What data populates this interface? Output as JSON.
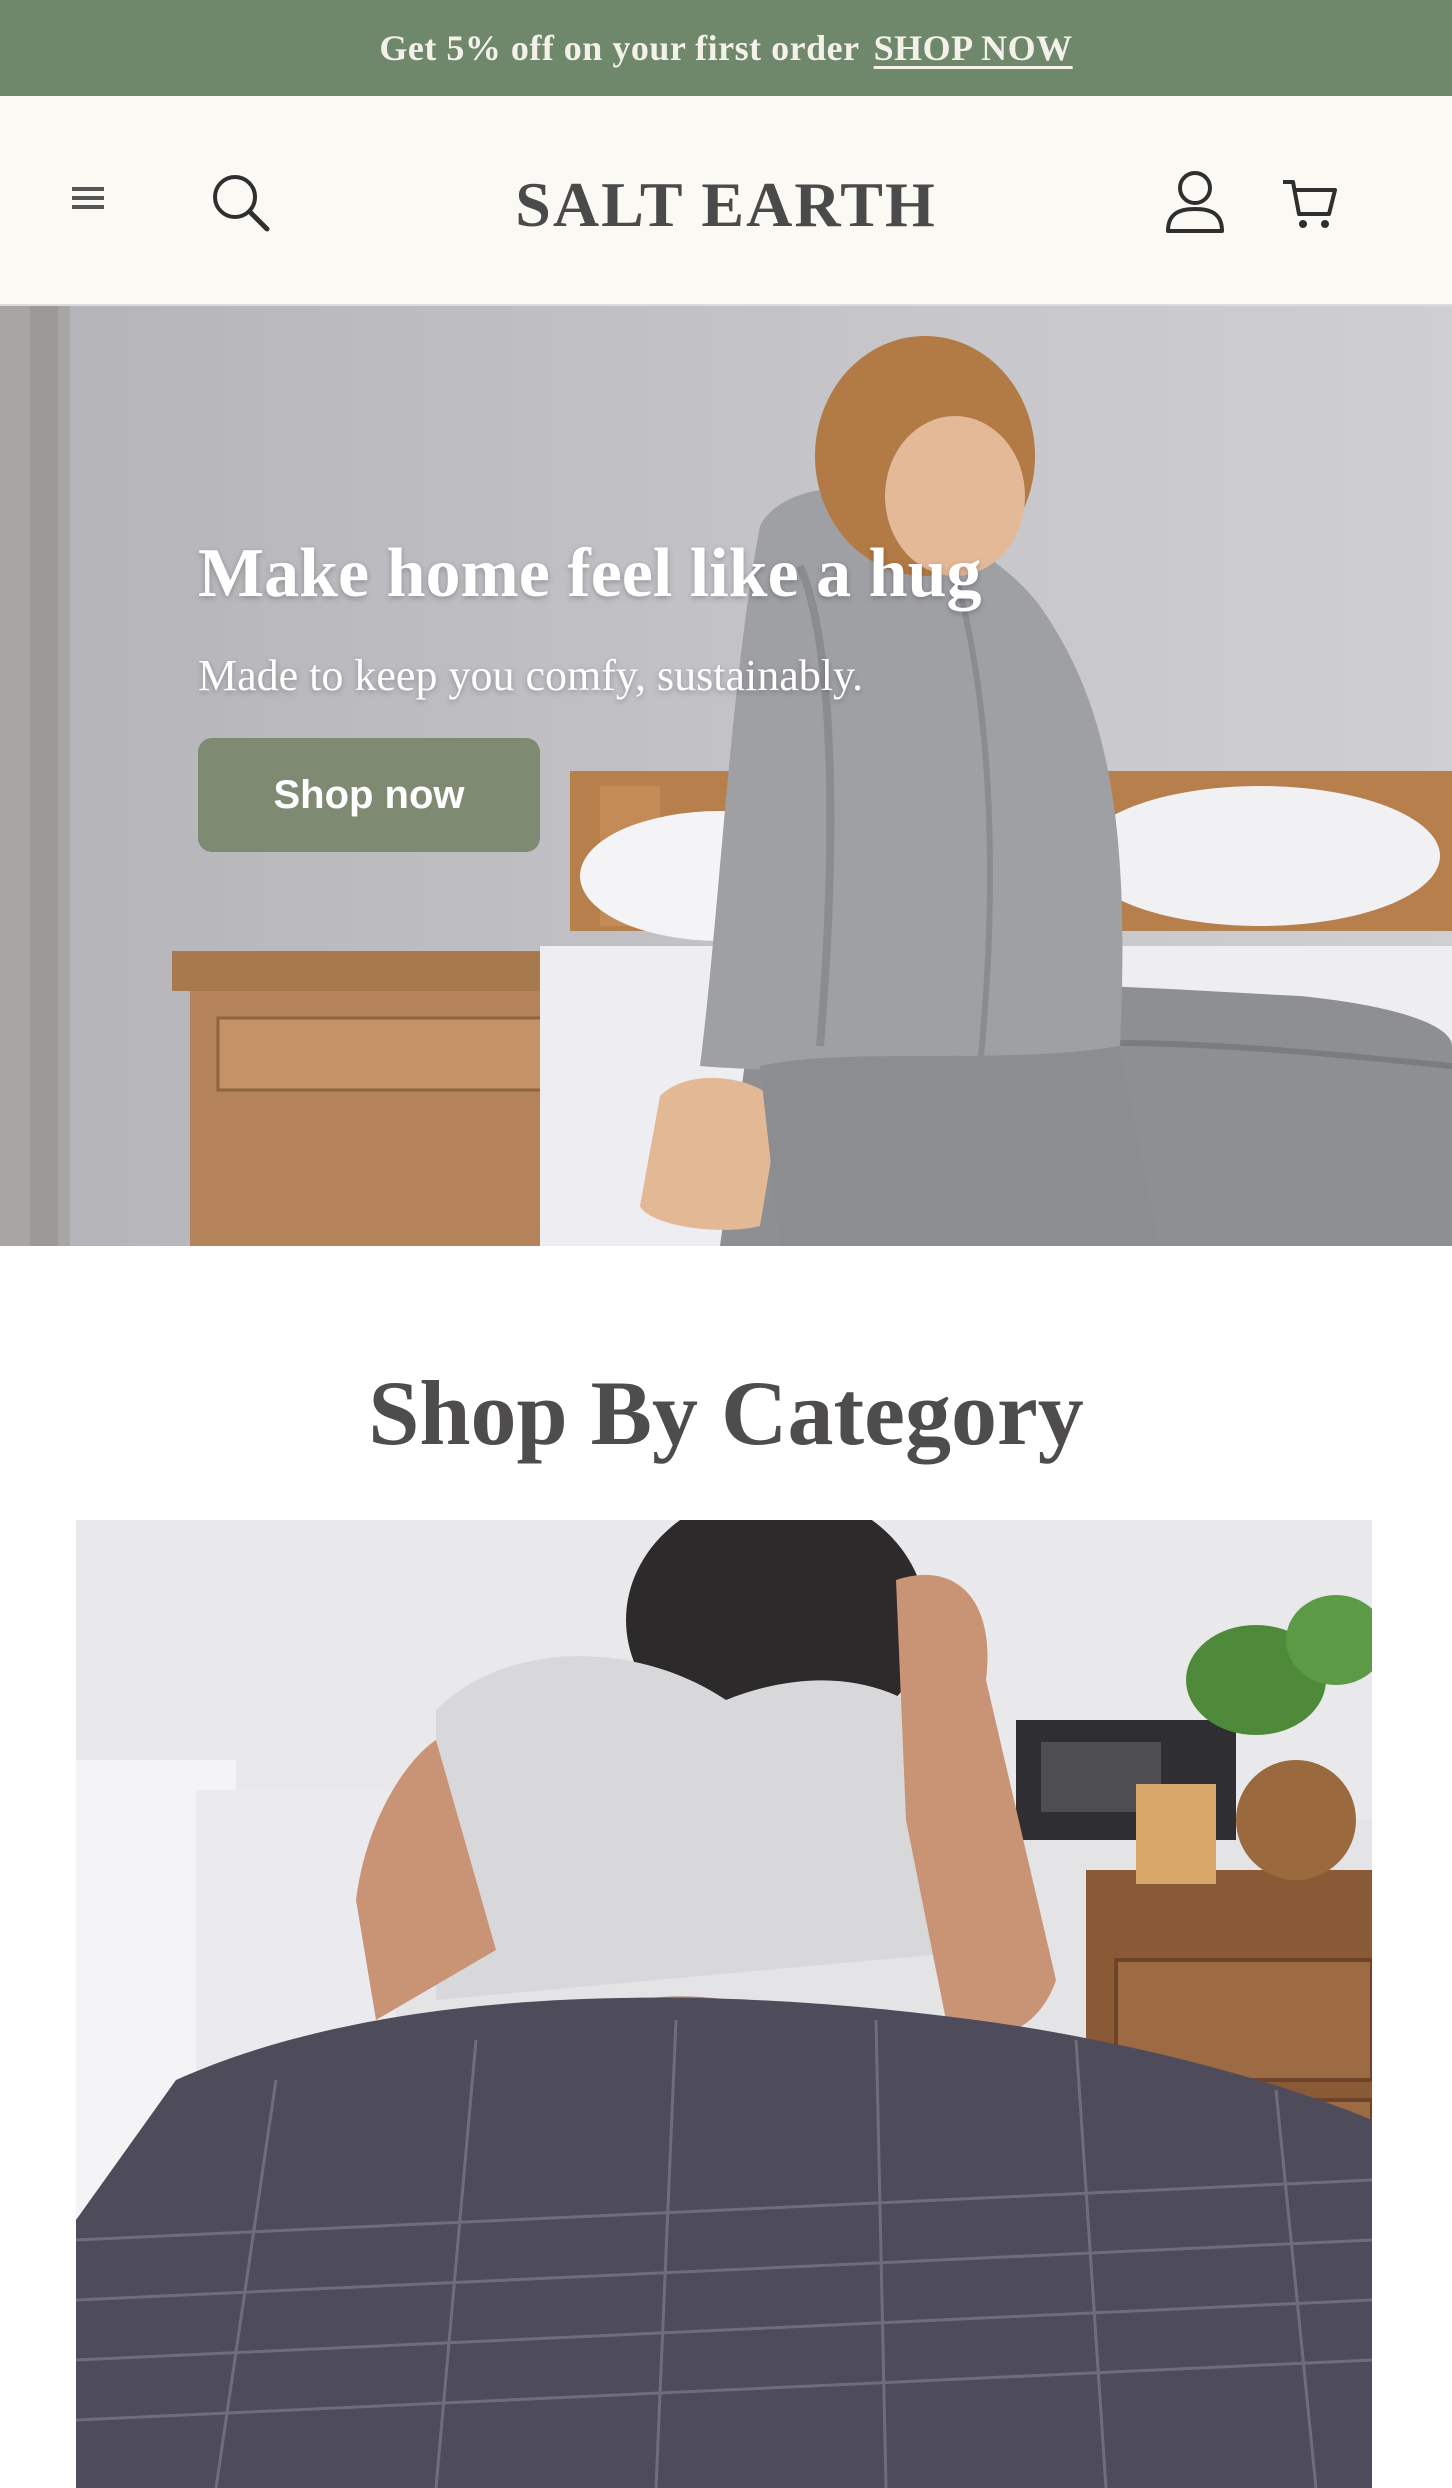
{
  "announcement": {
    "text": "Get 5% off on your first order",
    "link_label": "SHOP NOW"
  },
  "header": {
    "brand": "SALT EARTH",
    "icons": {
      "menu": "menu-icon",
      "search": "search-icon",
      "account": "user-icon",
      "cart": "cart-icon"
    }
  },
  "hero": {
    "title": "Make home feel like a hug",
    "subtitle": "Made to keep you comfy, sustainably.",
    "button_label": "Shop now"
  },
  "categories": {
    "title": "Shop By Category"
  },
  "colors": {
    "announcement_bg": "#6f876a",
    "header_bg": "#fbf9f3",
    "hero_button": "#7f8a73",
    "text_dark": "#4e4c4c"
  }
}
